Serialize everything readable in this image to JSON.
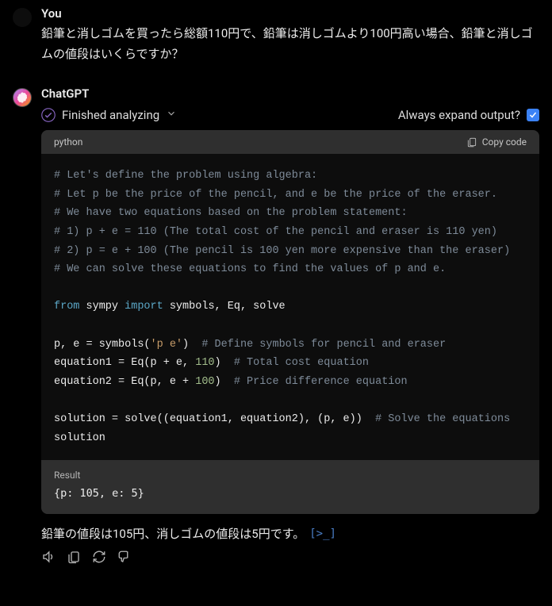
{
  "user": {
    "author": "You",
    "text": "鉛筆と消しゴムを買ったら総額110円で、鉛筆は消しゴムより100円高い場合、鉛筆と消しゴムの値段はいくらですか？"
  },
  "bot": {
    "author": "ChatGPT",
    "status": {
      "label": "Finished analyzing",
      "expand_label": "Always expand output?",
      "expand_checked": true
    },
    "code": {
      "lang": "python",
      "copy_label": "Copy code",
      "lines": {
        "c1": "# Let's define the problem using algebra:",
        "c2": "# Let p be the price of the pencil, and e be the price of the eraser.",
        "c3": "# We have two equations based on the problem statement:",
        "c4": "# 1) p + e = 110 (The total cost of the pencil and eraser is 110 yen)",
        "c5": "# 2) p = e + 100 (The pencil is 100 yen more expensive than the eraser)",
        "c6": "# We can solve these equations to find the values of p and e.",
        "kw_from": "from",
        "sympy": " sympy ",
        "kw_import": "import",
        "imp_tail": " symbols, Eq, solve",
        "sym_head": "p, e = symbols(",
        "sym_str": "'p e'",
        "sym_close": ")  ",
        "cdef": "# Define symbols for pencil and eraser",
        "eq1_head": "equation1 = Eq(p + e, ",
        "n110": "110",
        "eq1_close": ")  ",
        "ctotal": "# Total cost equation",
        "eq2_head": "equation2 = Eq(p, e + ",
        "n100": "100",
        "eq2_close": ")  ",
        "cdiff": "# Price difference equation",
        "solve_head": "solution = solve((equation1, equation2), (p, e))  ",
        "csolve": "# Solve the equations",
        "ret": "solution"
      }
    },
    "result": {
      "label": "Result",
      "value": "{p: 105, e: 5}"
    },
    "answer": "鉛筆の値段は105円、消しゴムの値段は5円です。",
    "code_ref": "[>_]"
  }
}
